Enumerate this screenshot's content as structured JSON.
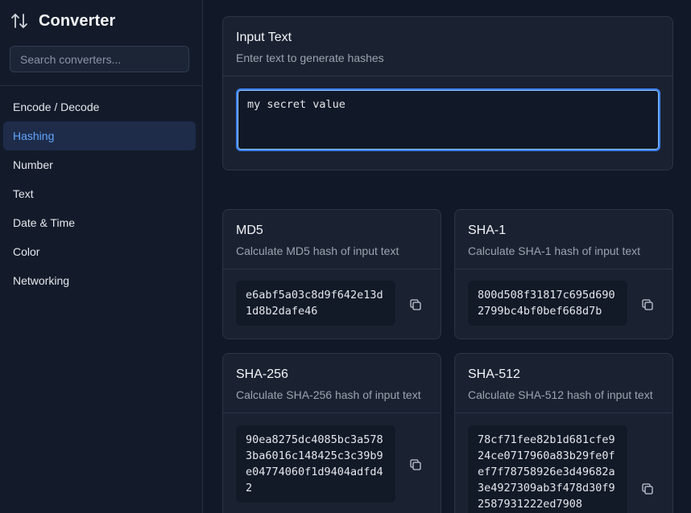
{
  "sidebar": {
    "title": "Converter",
    "brand_icon": "arrows-up-down-icon",
    "search_placeholder": "Search converters...",
    "items": [
      {
        "label": "Encode / Decode",
        "active": false
      },
      {
        "label": "Hashing",
        "active": true
      },
      {
        "label": "Number",
        "active": false
      },
      {
        "label": "Text",
        "active": false
      },
      {
        "label": "Date & Time",
        "active": false
      },
      {
        "label": "Color",
        "active": false
      },
      {
        "label": "Networking",
        "active": false
      }
    ]
  },
  "input": {
    "title": "Input Text",
    "description": "Enter text to generate hashes",
    "value": "my secret value"
  },
  "hashes": [
    {
      "title": "MD5",
      "description": "Calculate MD5 hash of input text",
      "value": "e6abf5a03c8d9f642e13d1d8b2dafe46",
      "icon": "copy-icon"
    },
    {
      "title": "SHA-1",
      "description": "Calculate SHA-1 hash of input text",
      "value": "800d508f31817c695d6902799bc4bf0bef668d7b",
      "icon": "copy-icon"
    },
    {
      "title": "SHA-256",
      "description": "Calculate SHA-256 hash of input text",
      "value": "90ea8275dc4085bc3a5783ba6016c148425c3c39b9e04774060f1d9404adfd42",
      "icon": "copy-icon"
    },
    {
      "title": "SHA-512",
      "description": "Calculate SHA-512 hash of input text",
      "value": "78cf71fee82b1d681cfe924ce0717960a83b29fe0fef7f78758926e3d49682a3e4927309ab3f478d30f92587931222ed7908",
      "icon": "copy-icon"
    }
  ],
  "colors": {
    "background": "#111827",
    "sidebar": "#131b2b",
    "card": "#1a2232",
    "accent": "#3b82f6",
    "active_text": "#60a5fa"
  }
}
